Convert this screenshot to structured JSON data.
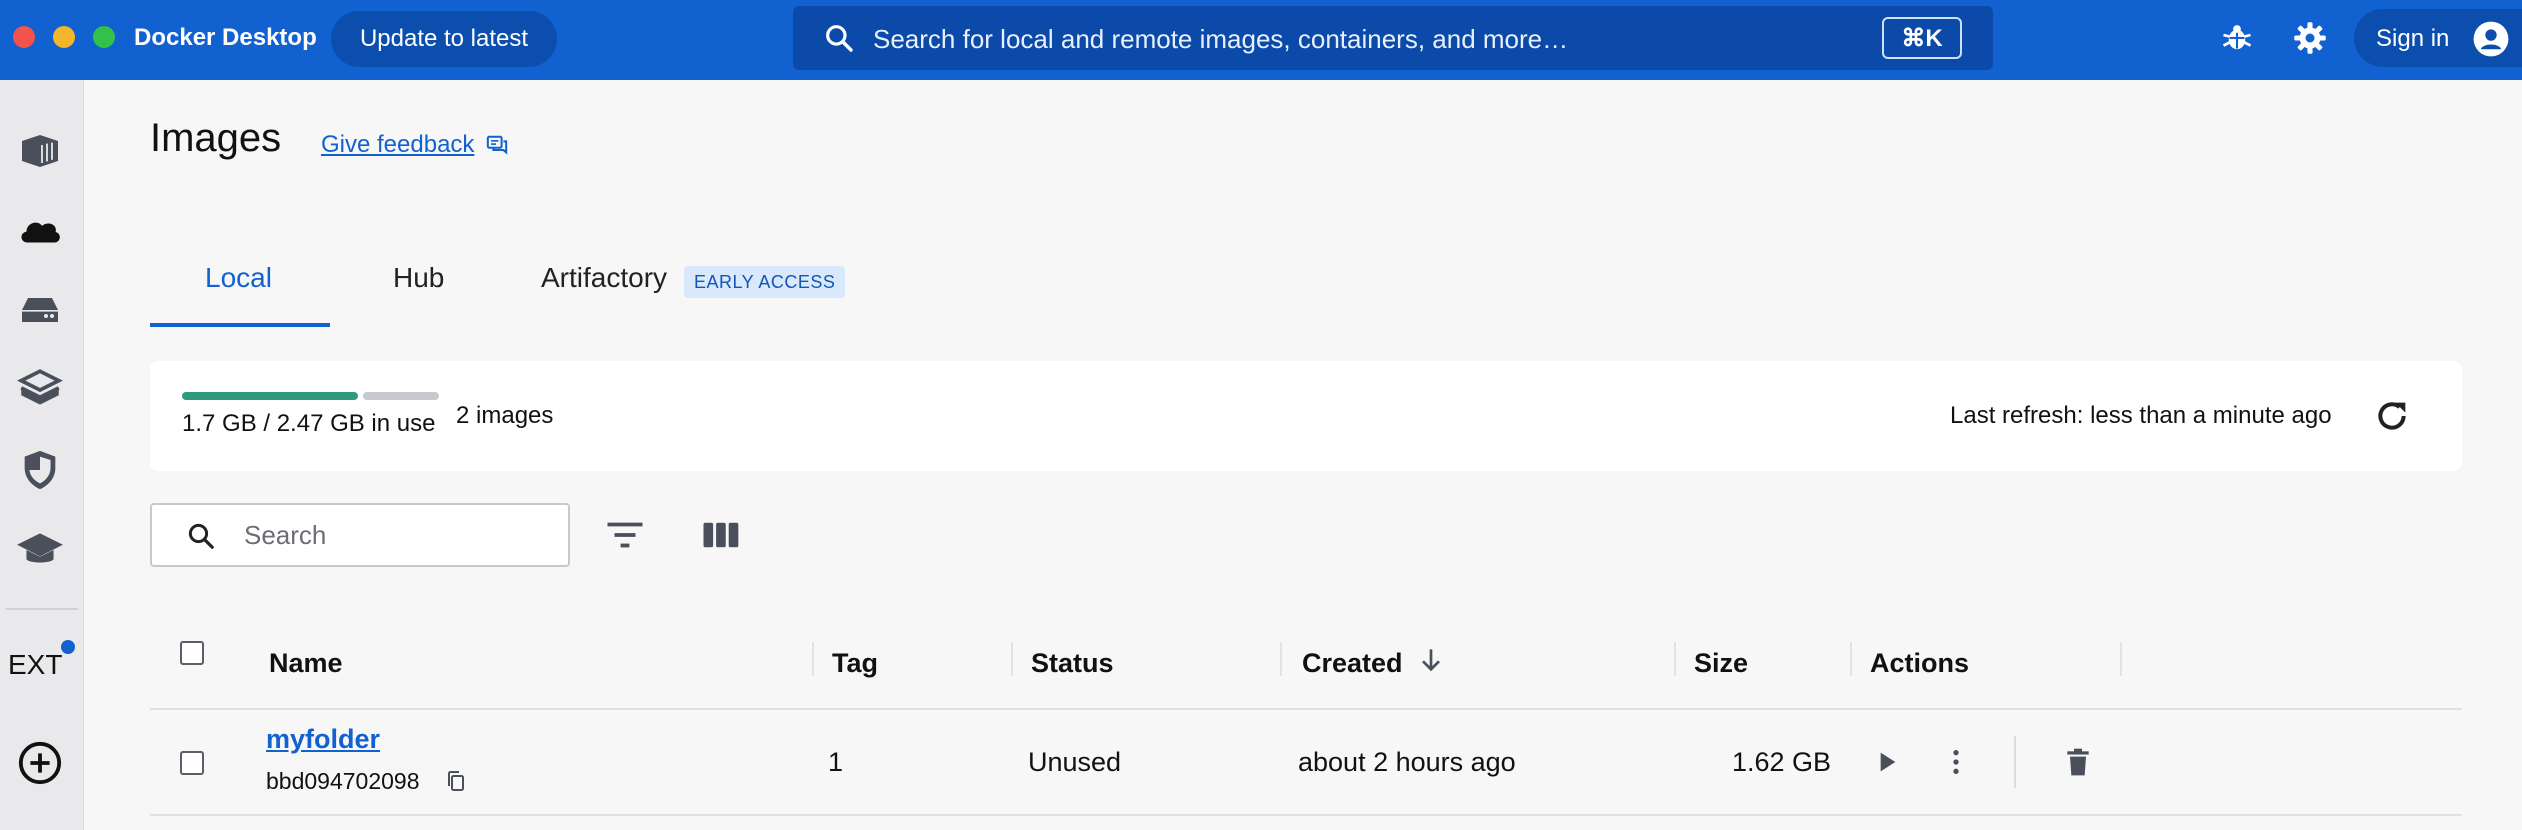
{
  "app": {
    "title": "Docker Desktop",
    "update_label": "Update to latest",
    "search_placeholder": "Search for local and remote images, containers, and more…",
    "search_shortcut": "⌘K",
    "signin_label": "Sign in",
    "brand_color": "#1261d1"
  },
  "sidebar": {
    "items": [
      {
        "icon": "containers-icon"
      },
      {
        "icon": "cloud-icon"
      },
      {
        "icon": "volumes-icon"
      },
      {
        "icon": "builds-icon"
      },
      {
        "icon": "scout-shield-icon"
      },
      {
        "icon": "learning-center-icon"
      }
    ],
    "ext_label": "EXT",
    "add_icon": "add-extension-icon"
  },
  "page": {
    "title": "Images",
    "feedback_label": "Give feedback"
  },
  "tabs": [
    {
      "label": "Local",
      "active": true
    },
    {
      "label": "Hub",
      "active": false
    },
    {
      "label": "Artifactory",
      "active": false,
      "badge": "EARLY ACCESS"
    }
  ],
  "usage": {
    "text": "1.7 GB / 2.47 GB in use",
    "used_fraction": 0.69,
    "count": "2 images",
    "refresh": "Last refresh: less than a minute ago"
  },
  "toolbar": {
    "search_placeholder": "Search"
  },
  "table": {
    "columns": [
      "Name",
      "Tag",
      "Status",
      "Created",
      "Size",
      "Actions"
    ],
    "rows": [
      {
        "name": "myfolder",
        "id": "bbd094702098",
        "tag": "1",
        "status": "Unused",
        "created": "about 2 hours ago",
        "size": "1.62 GB"
      }
    ]
  }
}
